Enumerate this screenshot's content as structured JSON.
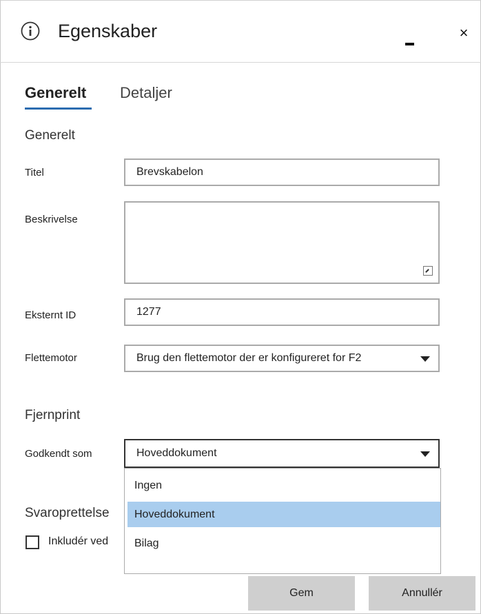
{
  "window": {
    "title": "Egenskaber",
    "minimize_icon": "minimize-icon",
    "close_label": "×"
  },
  "tabs": [
    {
      "label": "Generelt",
      "active": true
    },
    {
      "label": "Detaljer",
      "active": false
    }
  ],
  "general": {
    "section_title": "Generelt",
    "title_label": "Titel",
    "title_value": "Brevskabelon",
    "description_label": "Beskrivelse",
    "description_value": "",
    "external_id_label": "Eksternt ID",
    "external_id_value": "1277",
    "merge_engine_label": "Flettemotor",
    "merge_engine_value": "Brug den flettemotor der er konfigureret for F2"
  },
  "remote_print": {
    "section_title": "Fjernprint",
    "approved_as_label": "Godkendt som",
    "approved_as_value": "Hoveddokument",
    "options": [
      {
        "label": "Ingen",
        "selected": false
      },
      {
        "label": "Hoveddokument",
        "selected": true
      },
      {
        "label": "Bilag",
        "selected": false
      }
    ]
  },
  "reply": {
    "section_title": "Svaroprettelse",
    "include_label": "Inkludér ved",
    "include_checked": false
  },
  "buttons": {
    "save": "Gem",
    "cancel": "Annullér"
  },
  "colors": {
    "accent": "#2b6cb0",
    "selected_option": "#a9cdee",
    "button_bg": "#cfcfcf"
  }
}
